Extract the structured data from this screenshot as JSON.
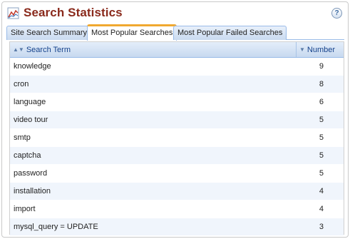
{
  "header": {
    "title": "Search Statistics",
    "chart_icon": "line-chart-icon",
    "help_icon": "help-icon",
    "help_label": "?"
  },
  "tabs": [
    {
      "label": "Site Search Summary",
      "active": false
    },
    {
      "label": "Most Popular Searches",
      "active": true
    },
    {
      "label": "Most Popular Failed Searches",
      "active": false
    }
  ],
  "grid": {
    "columns": {
      "term": "Search Term",
      "number": "Number"
    },
    "rows": [
      {
        "term": "knowledge",
        "number": "9"
      },
      {
        "term": "cron",
        "number": "8"
      },
      {
        "term": "language",
        "number": "6"
      },
      {
        "term": "video tour",
        "number": "5"
      },
      {
        "term": "smtp",
        "number": "5"
      },
      {
        "term": "captcha",
        "number": "5"
      },
      {
        "term": "password",
        "number": "5"
      },
      {
        "term": "installation",
        "number": "4"
      },
      {
        "term": "import",
        "number": "4"
      },
      {
        "term": "mysql_query = UPDATE",
        "number": "3"
      }
    ]
  },
  "colors": {
    "title": "#8a2a1c",
    "tab_active_accent": "#f0a830",
    "header_text": "#15428b",
    "row_alt": "#f0f5fc"
  }
}
